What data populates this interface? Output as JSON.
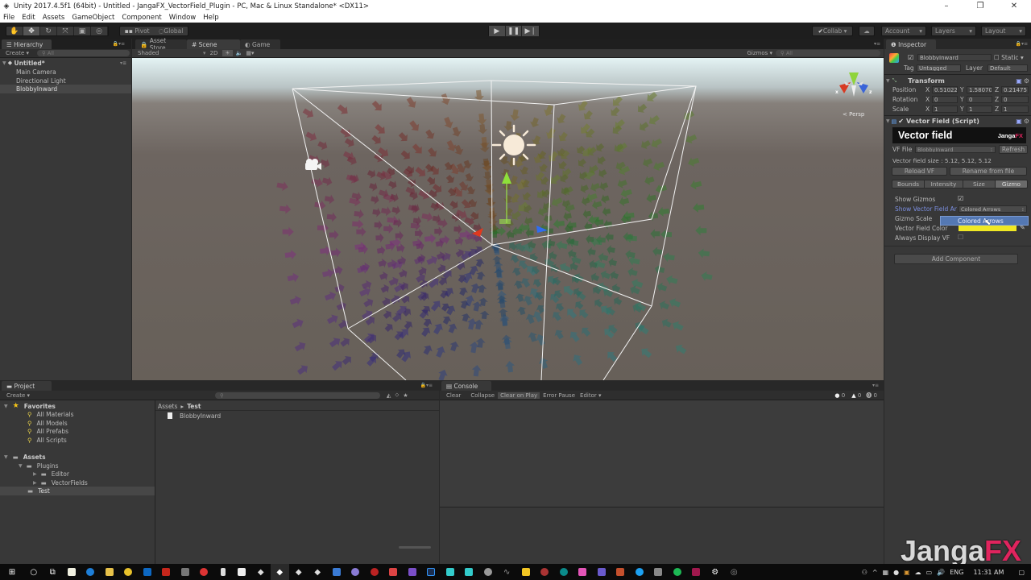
{
  "window": {
    "title": "Unity 2017.4.5f1 (64bit) - Untitled - JangaFX_VectorField_Plugin - PC, Mac & Linux Standalone* <DX11>",
    "controls": [
      "minimize",
      "restore",
      "close"
    ]
  },
  "menu": [
    "File",
    "Edit",
    "Assets",
    "GameObject",
    "Component",
    "Window",
    "Help"
  ],
  "toolbar": {
    "tools": [
      "hand-tool",
      "move-tool",
      "rotate-tool",
      "scale-tool",
      "rect-tool",
      "transform-tool"
    ],
    "selected_tool": "move-tool",
    "pivot": "Pivot",
    "global": "Global",
    "play": "play",
    "pause": "pause",
    "step": "step",
    "collab": "Collab",
    "account": "Account",
    "layers": "Layers",
    "layout": "Layout"
  },
  "hierarchy": {
    "tab": "Hierarchy",
    "create": "Create",
    "search_placeholder": "All",
    "scene_name": "Untitled*",
    "items": [
      "Main Camera",
      "Directional Light",
      "BlobbyInward"
    ],
    "selected": "BlobbyInward"
  },
  "scene_view": {
    "tabs": [
      "Asset Store",
      "Scene",
      "Game"
    ],
    "active_tab": "Scene",
    "shading_mode": "Shaded",
    "mode_2d": "2D",
    "gizmos": "Gizmos",
    "gizmo_search_placeholder": "All",
    "projection": "Persp",
    "axis_labels": {
      "x": "x",
      "z": "z"
    }
  },
  "inspector": {
    "tab": "Inspector",
    "object_name": "BlobbyInward",
    "active": true,
    "static_label": "Static",
    "tag_label": "Tag",
    "tag": "Untagged",
    "layer_label": "Layer",
    "layer": "Default",
    "transform": {
      "title": "Transform",
      "position": {
        "label": "Position",
        "x": "0.51022",
        "y": "1.58070",
        "z": "0.21475"
      },
      "rotation": {
        "label": "Rotation",
        "x": "0",
        "y": "0",
        "z": "0"
      },
      "scale": {
        "label": "Scale",
        "x": "1",
        "y": "1",
        "z": "1"
      }
    },
    "vector_field": {
      "title": "Vector Field (Script)",
      "banner_title": "Vector field",
      "banner_brand_a": "Janga",
      "banner_brand_b": "FX",
      "vf_file_label": "VF File",
      "vf_file": "BlobbyInward",
      "refresh": "Refresh",
      "size_text": "Vector field size : 5.12, 5.12, 5.12",
      "reload": "Reload VF",
      "rename": "Rename from file",
      "tabs": [
        "Bounds",
        "Intensity",
        "Size",
        "Gizmo"
      ],
      "active_tab": "Gizmo",
      "show_gizmos_label": "Show Gizmos",
      "show_gizmos": true,
      "show_arrows_label": "Show Vector Field Ar",
      "arrows_mode": "Colored Arrows",
      "dropdown_option": "Colored Arrows",
      "gizmo_scale_label": "Gizmo Scale",
      "color_label": "Vector Field Color",
      "color": "#f0e824",
      "always_display_label": "Always Display VF",
      "always_display": false
    },
    "add_component": "Add Component"
  },
  "project": {
    "tab": "Project",
    "create": "Create",
    "favorites_label": "Favorites",
    "favorites": [
      "All Materials",
      "All Models",
      "All Prefabs",
      "All Scripts"
    ],
    "assets_label": "Assets",
    "tree": [
      {
        "name": "Plugins",
        "level": 1
      },
      {
        "name": "Editor",
        "level": 2
      },
      {
        "name": "VectorFields",
        "level": 2
      },
      {
        "name": "Test",
        "level": 1
      }
    ],
    "selected_folder": "Test",
    "breadcrumb": [
      "Assets",
      "Test"
    ],
    "files": [
      "BlobbyInward"
    ]
  },
  "console": {
    "tab": "Console",
    "buttons": [
      "Clear",
      "Collapse",
      "Clear on Play",
      "Error Pause",
      "Editor"
    ],
    "active_button": "Clear on Play",
    "counts": {
      "info": "0",
      "warning": "0",
      "error": "0"
    }
  },
  "taskbar": {
    "language": "ENG",
    "time": "11:31 AM"
  },
  "watermark": {
    "a": "Janga",
    "b": "FX"
  },
  "colors": {
    "accent_selected": "#3e5f96",
    "brand_fx": "#e0245e",
    "vf_color": "#f0e824"
  }
}
